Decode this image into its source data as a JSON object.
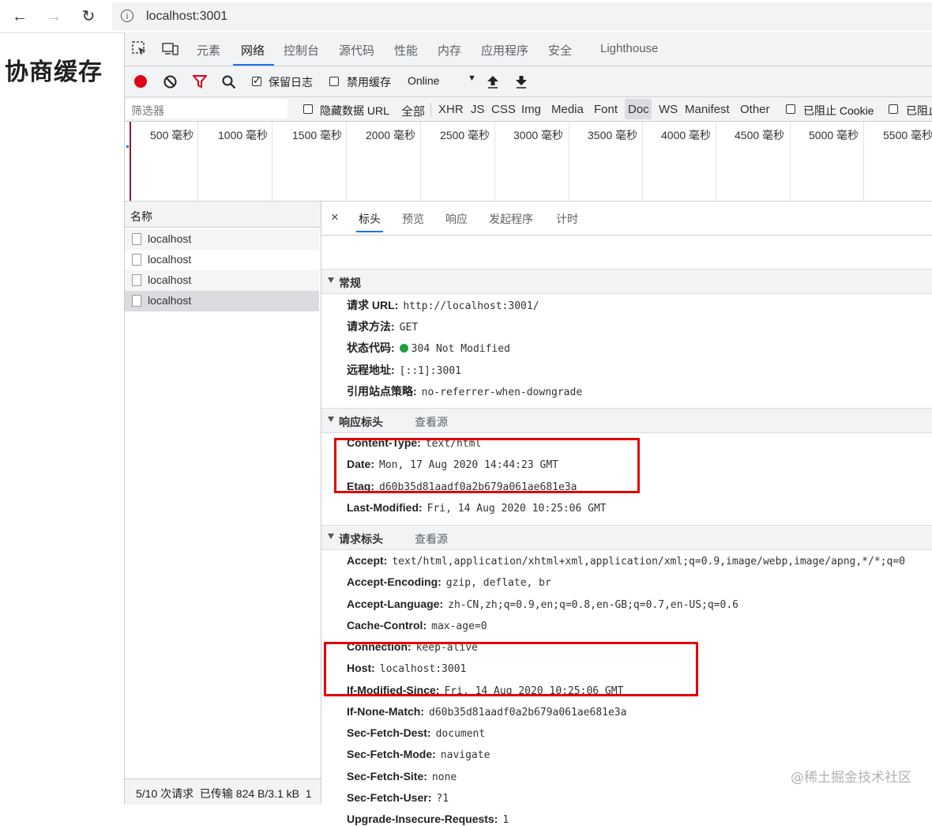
{
  "browser": {
    "url": "localhost:3001",
    "back_icon": "←",
    "forward_icon": "→",
    "reload_icon": "↻"
  },
  "page": {
    "heading": "协商缓存"
  },
  "devtools": {
    "tabs": [
      "元素",
      "网络",
      "控制台",
      "源代码",
      "性能",
      "内存",
      "应用程序",
      "安全",
      "Lighthouse"
    ],
    "active_tab": "网络",
    "toolbar": {
      "preserve_log": "保留日志",
      "disable_cache": "禁用缓存",
      "throttle": "Online"
    },
    "filter": {
      "placeholder": "筛选器",
      "hide_data_url": "隐藏数据 URL",
      "types": [
        "全部",
        "XHR",
        "JS",
        "CSS",
        "Img",
        "Media",
        "Font",
        "Doc",
        "WS",
        "Manifest",
        "Other"
      ],
      "active_type": "Doc",
      "blocked_cookies": "已阻止 Cookie",
      "blocked_requests": "已阻止"
    },
    "timeline_ticks": [
      "500 毫秒",
      "1000 毫秒",
      "1500 毫秒",
      "2000 毫秒",
      "2500 毫秒",
      "3000 毫秒",
      "3500 毫秒",
      "4000 毫秒",
      "4500 毫秒",
      "5000 毫秒",
      "5500 毫秒"
    ],
    "name_column": "名称",
    "requests": [
      "localhost",
      "localhost",
      "localhost",
      "localhost"
    ],
    "status_bar": "5/10 次请求  已传输 824 B/3.1 kB  1",
    "detail_tabs": [
      "标头",
      "预览",
      "响应",
      "发起程序",
      "计时"
    ],
    "close_icon": "×",
    "general": {
      "title": "常规",
      "rows": [
        {
          "key": "请求 URL:",
          "value": "http://localhost:3001/"
        },
        {
          "key": "请求方法:",
          "value": "GET"
        },
        {
          "key": "状态代码:",
          "value": "304 Not Modified"
        },
        {
          "key": "远程地址:",
          "value": "[::1]:3001"
        },
        {
          "key": "引用站点策略:",
          "value": "no-referrer-when-downgrade"
        }
      ]
    },
    "response_headers": {
      "title": "响应标头",
      "view_source": "查看源",
      "rows": [
        {
          "key": "Content-Type:",
          "value": "text/html"
        },
        {
          "key": "Date:",
          "value": "Mon, 17 Aug 2020 14:44:23 GMT"
        },
        {
          "key": "Etag:",
          "value": "d60b35d81aadf0a2b679a061ae681e3a"
        },
        {
          "key": "Last-Modified:",
          "value": "Fri, 14 Aug 2020 10:25:06 GMT"
        }
      ]
    },
    "request_headers": {
      "title": "请求标头",
      "view_source": "查看源",
      "rows": [
        {
          "key": "Accept:",
          "value": "text/html,application/xhtml+xml,application/xml;q=0.9,image/webp,image/apng,*/*;q=0"
        },
        {
          "key": "Accept-Encoding:",
          "value": "gzip, deflate, br"
        },
        {
          "key": "Accept-Language:",
          "value": "zh-CN,zh;q=0.9,en;q=0.8,en-GB;q=0.7,en-US;q=0.6"
        },
        {
          "key": "Cache-Control:",
          "value": "max-age=0"
        },
        {
          "key": "Connection:",
          "value": "keep-alive"
        },
        {
          "key": "Host:",
          "value": "localhost:3001"
        },
        {
          "key": "If-Modified-Since:",
          "value": "Fri, 14 Aug 2020 10:25:06 GMT"
        },
        {
          "key": "If-None-Match:",
          "value": "d60b35d81aadf0a2b679a061ae681e3a"
        },
        {
          "key": "Sec-Fetch-Dest:",
          "value": "document"
        },
        {
          "key": "Sec-Fetch-Mode:",
          "value": "navigate"
        },
        {
          "key": "Sec-Fetch-Site:",
          "value": "none"
        },
        {
          "key": "Sec-Fetch-User:",
          "value": "?1"
        },
        {
          "key": "Upgrade-Insecure-Requests:",
          "value": "1"
        }
      ]
    }
  },
  "watermark": "@稀土掘金技术社区",
  "colors": {
    "accent": "#1a73e8",
    "record": "#e0001b",
    "highlight_box": "#e50000",
    "status_ok": "#1e9e3c"
  }
}
